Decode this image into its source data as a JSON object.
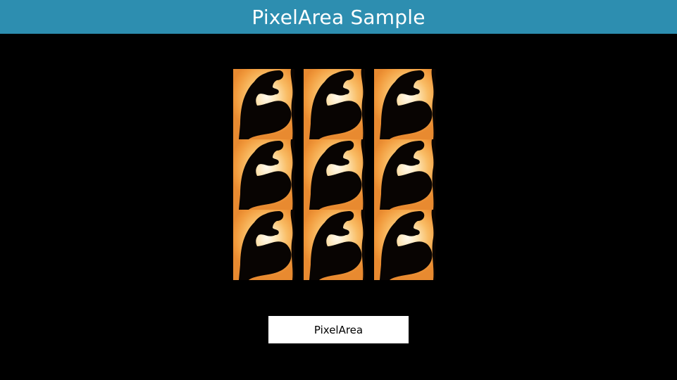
{
  "app": {
    "title": "PixelArea Sample",
    "accent_color": "#2d8eb0",
    "background_color": "#000000"
  },
  "image_grid": {
    "rows": 3,
    "columns": 3,
    "tile_image": "flexed-arm-silhouette"
  },
  "action_button": {
    "label": "PixelArea"
  }
}
